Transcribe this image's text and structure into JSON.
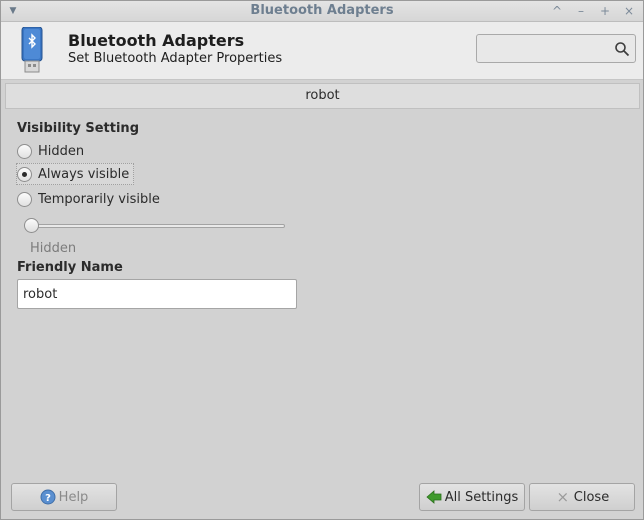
{
  "window": {
    "title": "Bluetooth Adapters"
  },
  "header": {
    "title": "Bluetooth Adapters",
    "subtitle": "Set Bluetooth Adapter Properties",
    "search": {
      "value": "",
      "placeholder": ""
    }
  },
  "adapter_tab": {
    "label": "robot"
  },
  "visibility": {
    "title": "Visibility Setting",
    "options": [
      {
        "label": "Hidden",
        "selected": false
      },
      {
        "label": "Always visible",
        "selected": true
      },
      {
        "label": "Temporarily visible",
        "selected": false
      }
    ],
    "timeout_slider": {
      "value_fraction": 0.0,
      "label": "Hidden"
    }
  },
  "friendly_name": {
    "title": "Friendly Name",
    "value": "robot"
  },
  "buttons": {
    "help": "Help",
    "all_settings": "All Settings",
    "close": "Close"
  },
  "colors": {
    "help_icon": "#5a8fd0",
    "all_settings_icon": "#3f9a2c",
    "titlebar_text": "#6e7f90"
  }
}
